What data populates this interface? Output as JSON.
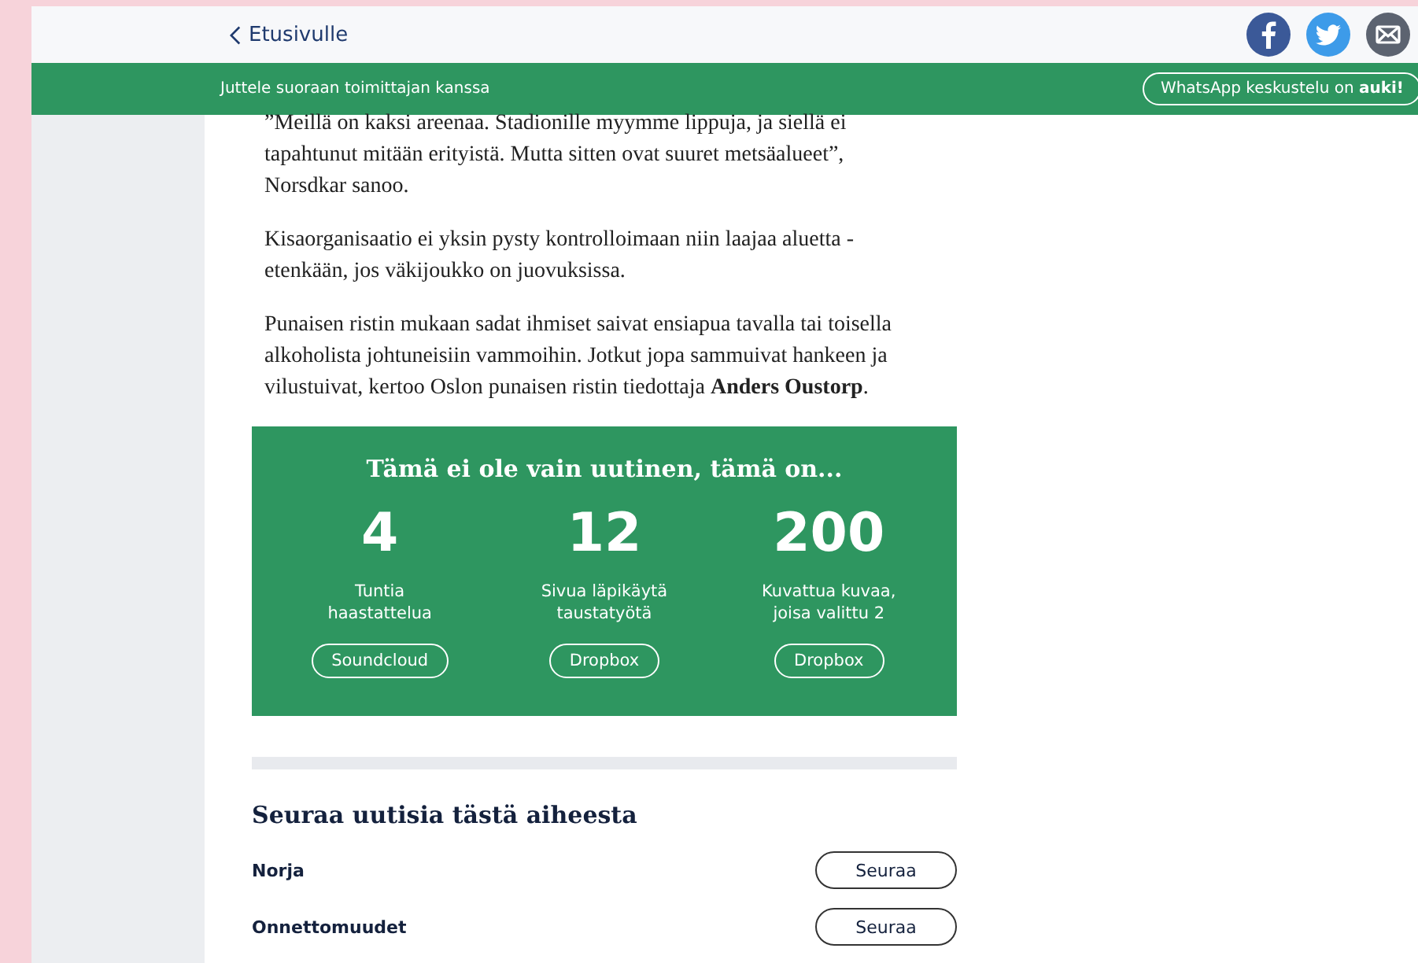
{
  "header": {
    "back_link": "Etusivulle",
    "share": [
      {
        "kind": "facebook"
      },
      {
        "kind": "twitter"
      },
      {
        "kind": "email"
      }
    ]
  },
  "chat_bar": {
    "text": "Juttele suoraan toimittajan kanssa",
    "button": "WhatsApp keskustelu on **auki!**"
  },
  "article": {
    "paragraphs": [
      "”Meillä on kaksi areenaa. Stadionille myymme lippuja, ja siellä ei tapahtunut mitään erityistä. Mutta sitten ovat suuret metsäalueet”, Norsdkar sanoo.",
      "Kisaorganisaatio ei yksin pysty kontrolloimaan niin laajaa aluetta - etenkään, jos väkijoukko on juovuksissa.",
      "Punaisen ristin mukaan sadat ihmiset saivat ensiapua tavalla tai toisella alkoholista johtuneisiin vammoihin. Jotkut jopa sammuivat hankeen ja vilustuivat, kertoo Oslon punaisen ristin tiedottaja **Anders Oustorp**."
    ]
  },
  "facts_box": {
    "title": "Tämä ei ole vain uutinen, tämä on...",
    "facts": [
      {
        "number": "4",
        "label": "Tuntia haastattelua",
        "button": "Soundcloud"
      },
      {
        "number": "12",
        "label": "Sivua läpikäytä taustatyötä",
        "button": "Dropbox"
      },
      {
        "number": "200",
        "label": "Kuvattua kuvaa, joisa valittu 2",
        "button": "Dropbox"
      }
    ]
  },
  "follow": {
    "title": "Seuraa uutisia tästä aiheesta",
    "topics": [
      {
        "name": "Norja",
        "button": "Seuraa"
      },
      {
        "name": "Onnettomuudet",
        "button": "Seuraa"
      }
    ]
  }
}
